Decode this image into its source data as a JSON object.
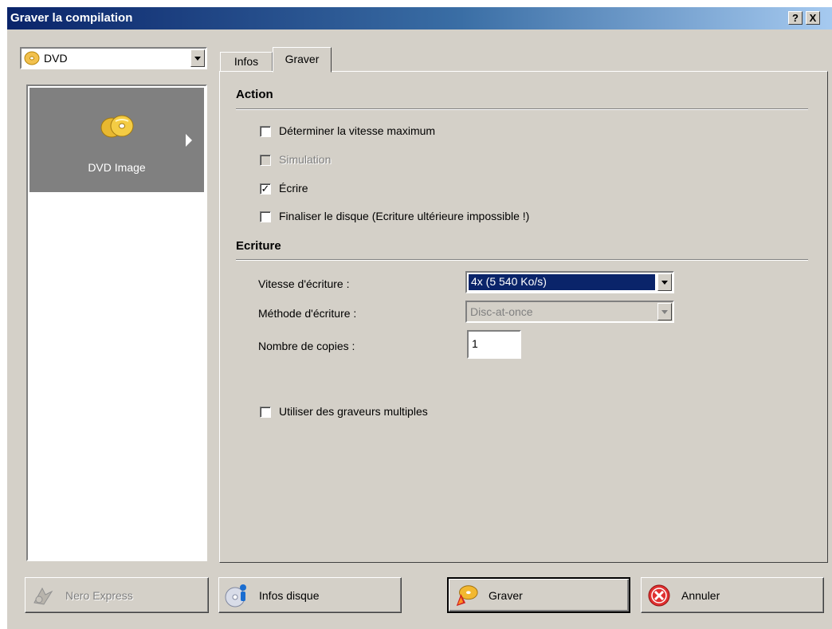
{
  "window": {
    "title": "Graver la compilation",
    "help_label": "?",
    "close_label": "X"
  },
  "media": {
    "selected": "DVD",
    "icon": "dvd-disc-icon"
  },
  "sidebar": {
    "items": [
      {
        "label": "DVD Image",
        "icon": "dvd-discs-icon",
        "selected": true
      }
    ]
  },
  "tabs": [
    {
      "label": "Infos",
      "active": false
    },
    {
      "label": "Graver",
      "active": true
    }
  ],
  "action": {
    "title": "Action",
    "options": [
      {
        "label": "Déterminer la vitesse maximum",
        "checked": false,
        "enabled": true
      },
      {
        "label": "Simulation",
        "checked": false,
        "enabled": false
      },
      {
        "label": "Écrire",
        "checked": true,
        "enabled": true
      },
      {
        "label": "Finaliser le disque (Ecriture ultérieure impossible !)",
        "checked": false,
        "enabled": true
      }
    ]
  },
  "ecriture": {
    "title": "Ecriture",
    "speed_label": "Vitesse d'écriture :",
    "speed_value": "4x (5 540 Ko/s)",
    "method_label": "Méthode d'écriture :",
    "method_value": "Disc-at-once",
    "copies_label": "Nombre de copies :",
    "copies_value": "1"
  },
  "multi": {
    "label": "Utiliser des graveurs multiples",
    "checked": false
  },
  "buttons": {
    "nero_express": "Nero Express",
    "infos_disque": "Infos disque",
    "graver": "Graver",
    "annuler": "Annuler"
  },
  "colors": {
    "dialog_bg": "#d4d0c8",
    "title_gradient_start": "#0a246a",
    "selection": "#0a246a",
    "sidebar_selected": "#808080"
  }
}
